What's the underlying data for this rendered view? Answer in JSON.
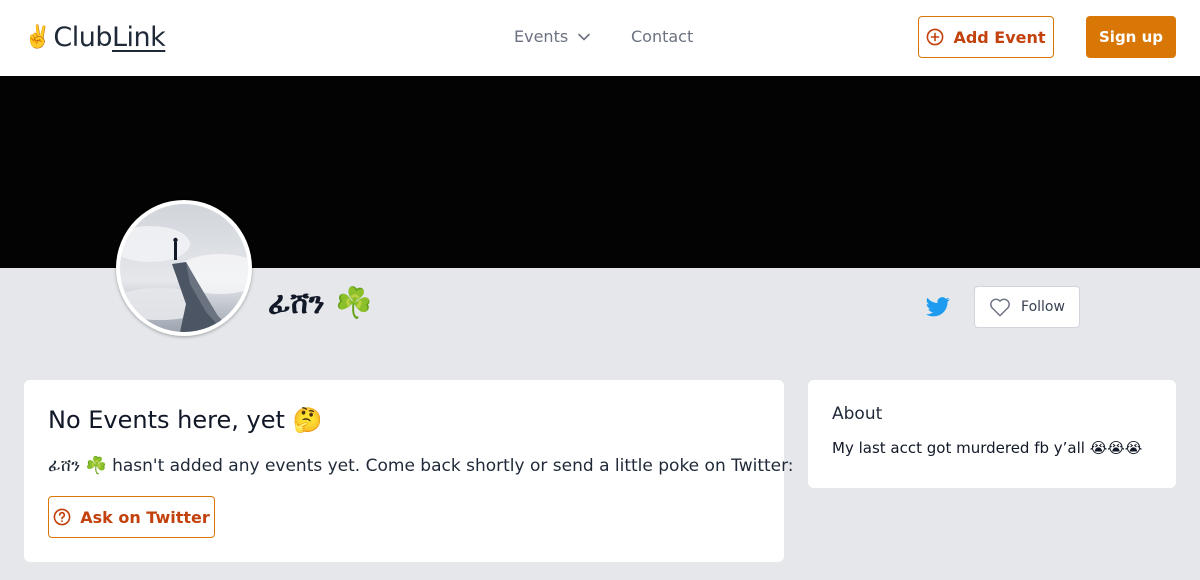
{
  "header": {
    "logo": {
      "icon": "✌️",
      "text_plain": "Club",
      "text_underlined": "Link"
    },
    "nav": {
      "events_label": "Events",
      "contact_label": "Contact"
    },
    "add_event_label": "Add Event",
    "signup_label": "Sign up"
  },
  "profile": {
    "name": "ፊሸን ☘️",
    "follow_label": "Follow",
    "twitter_icon": "twitter-icon"
  },
  "events_card": {
    "title": "No Events here, yet 🤔",
    "message": "ፊሸን ☘️ hasn't added any events yet. Come back shortly or send a little poke on Twitter:",
    "ask_label": "Ask on Twitter"
  },
  "about_card": {
    "title": "About",
    "text": "My last acct got murdered fb y’all 😭😭😭"
  },
  "colors": {
    "accent": "#d97706",
    "accent_text": "#c2410c",
    "twitter": "#1d9bf0",
    "page_bg": "#e5e7eb",
    "banner": "#030303"
  }
}
